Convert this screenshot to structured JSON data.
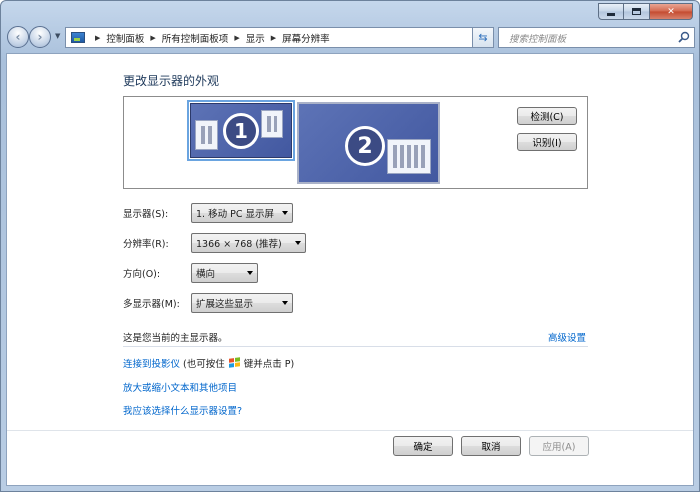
{
  "navigation": {
    "breadcrumb": [
      "控制面板",
      "所有控制面板项",
      "显示",
      "屏幕分辨率"
    ],
    "search_placeholder": "搜索控制面板"
  },
  "page": {
    "heading": "更改显示器的外观",
    "monitors": [
      {
        "number": "1",
        "selected": true
      },
      {
        "number": "2",
        "selected": false
      }
    ],
    "detect_label": "检测(C)",
    "identify_label": "识别(I)"
  },
  "settings": {
    "display": {
      "label": "显示器(S):",
      "value": "1. 移动 PC 显示屏"
    },
    "resolution": {
      "label": "分辨率(R):",
      "value": "1366 × 768 (推荐)"
    },
    "orientation": {
      "label": "方向(O):",
      "value": "横向"
    },
    "multiple_displays": {
      "label": "多显示器(M):",
      "value": "扩展这些显示"
    }
  },
  "status_text": "这是您当前的主显示器。",
  "advanced_link": "高级设置",
  "links": {
    "projector": "连接到投影仪",
    "projector_hint_prefix": "(也可按住",
    "projector_hint_suffix": "键并点击 P)",
    "text_size": "放大或缩小文本和其他项目",
    "which_settings": "我应该选择什么显示器设置?"
  },
  "footer": {
    "ok": "确定",
    "cancel": "取消",
    "apply": "应用(A)"
  },
  "colors": {
    "link": "#0066cc",
    "heading": "#1e395b",
    "monitor_fill": "#4f65aa",
    "selection_outline": "#6aa4e0"
  }
}
